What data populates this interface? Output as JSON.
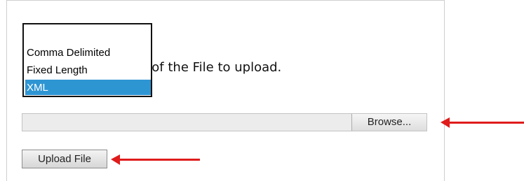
{
  "form": {
    "instruction": "d location of the File to upload.",
    "format_options": [
      "Comma Delimited",
      "Fixed Length",
      "XML"
    ],
    "selected_format": "XML",
    "file_path_value": "",
    "browse_label": "Browse...",
    "upload_label": "Upload File"
  },
  "annotations": {
    "arrow_color": "#e01b1b",
    "arrows": [
      "arrow-right-to-browse",
      "arrow-right-to-upload"
    ]
  },
  "colors": {
    "selection_highlight": "#2e95d3",
    "file_field_background": "#ececec"
  }
}
